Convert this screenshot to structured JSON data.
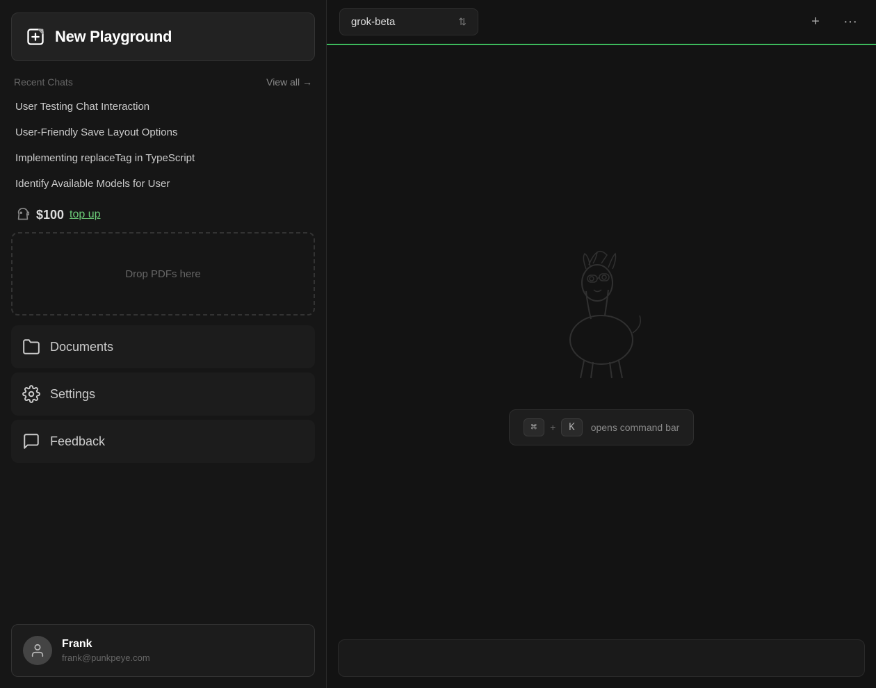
{
  "sidebar": {
    "new_playground_label": "New Playground",
    "recent_chats_label": "Recent Chats",
    "view_all_label": "View all →",
    "chats": [
      {
        "title": "User Testing Chat Interaction"
      },
      {
        "title": "User-Friendly Save Layout Options"
      },
      {
        "title": "Implementing replaceTag in TypeScript"
      },
      {
        "title": "Identify Available Models for User"
      }
    ],
    "balance": "$100",
    "top_up_label": "top up",
    "drop_pdfs_label": "Drop PDFs here",
    "documents_label": "Documents",
    "settings_label": "Settings",
    "feedback_label": "Feedback",
    "user": {
      "name": "Frank",
      "email": "frank@punkpeye.com"
    }
  },
  "toolbar": {
    "model_name": "grok-beta",
    "add_label": "+",
    "more_label": "···"
  },
  "shortcut": {
    "key1": "⌘",
    "plus": "+",
    "key2": "K",
    "hint": "opens command bar"
  }
}
